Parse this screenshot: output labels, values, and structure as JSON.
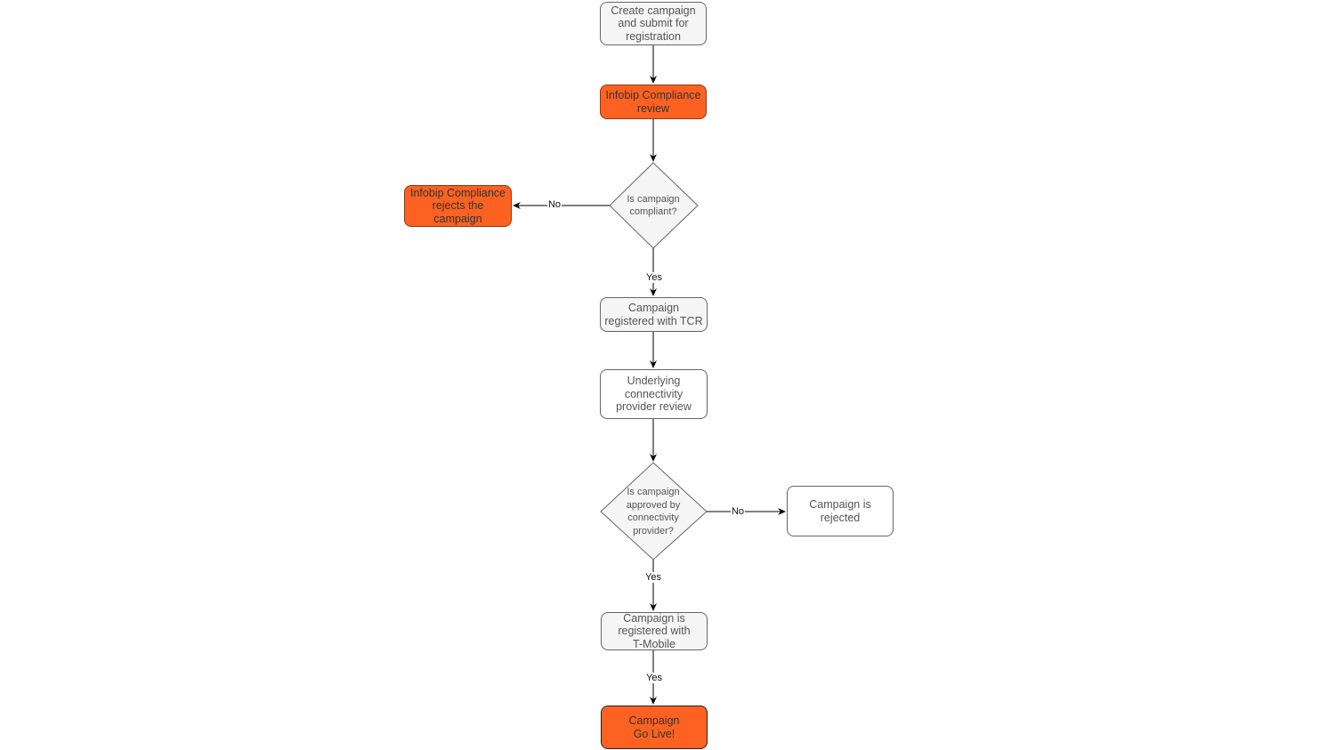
{
  "diagram": {
    "nodes": {
      "create": "Create campaign\nand submit for\nregistration",
      "compliance_review": "Infobip Compliance\nreview",
      "is_compliant": "Is campaign\ncompliant?",
      "rejects": "Infobip Compliance\nrejects the\ncampaign",
      "tcr": "Campaign\nregistered with TCR",
      "provider_review": "Underlying\nconnectivity\nprovider review",
      "is_approved": "Is campaign\napproved by\nconnectivity\nprovider?",
      "rejected": "Campaign is\nrejected",
      "tmobile": "Campaign is\nregistered with\nT-Mobile",
      "golive": "Campaign\nGo Live!"
    },
    "edge_labels": {
      "compliant_no": "No",
      "compliant_yes": "Yes",
      "approved_no": "No",
      "approved_yes": "Yes",
      "tmobile_yes": "Yes"
    },
    "colors": {
      "accent_orange": "#fe6222",
      "node_fill": "#f5f5f5",
      "edge": "#000000"
    }
  }
}
